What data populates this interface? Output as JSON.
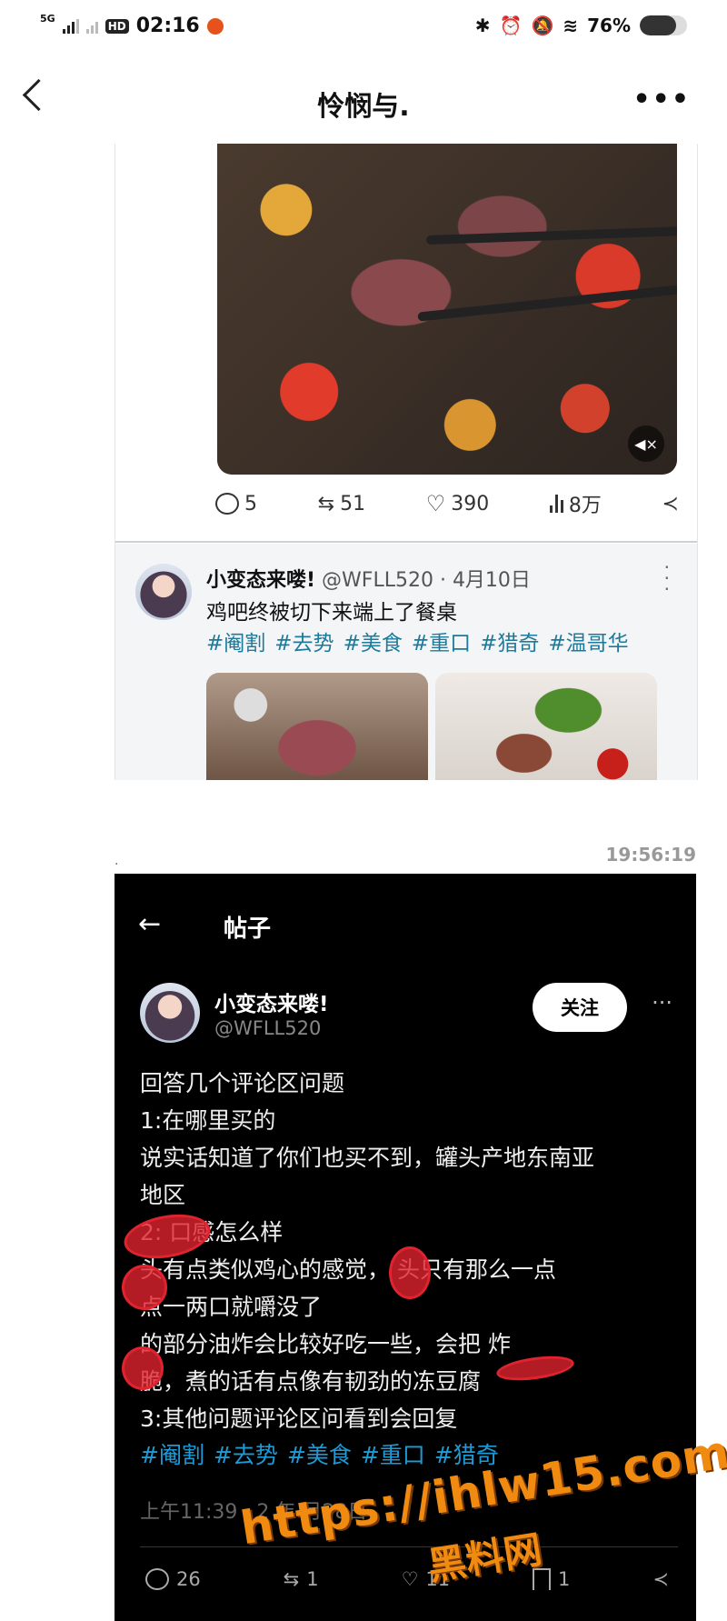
{
  "status_bar": {
    "network": "5G",
    "hd": "HD",
    "time": "02:16",
    "battery": "76%",
    "battery_level": 0.76
  },
  "header": {
    "title": "怜悯与."
  },
  "first_shot": {
    "actions": {
      "replies": "5",
      "reposts": "51",
      "likes": "390",
      "views": "8万"
    },
    "post": {
      "author": "小变态来喽!",
      "handle_date": "@WFLL520 · 4月10日",
      "text": "鸡吧终被切下来端上了餐桌",
      "tags": [
        "#阉割",
        "#去势",
        "#美食",
        "#重口",
        "#猎奇",
        "#温哥华"
      ]
    }
  },
  "message_time": "19:56:19",
  "dot_mark": ".",
  "second_shot": {
    "page_title": "帖子",
    "author": "小变态来喽!",
    "handle": "@WFLL520",
    "follow_label": "关注",
    "body_lines": [
      "回答几个评论区问题",
      "1:在哪里买的",
      "说实话知道了你们也买不到，罐头产地东南亚",
      "地区",
      "2:    口感怎么样",
      "    头有点类似鸡心的感觉，    头只有那么一点",
      "点一两口就嚼没了",
      "    的部分油炸会比较好吃一些，会把          炸",
      "脆，煮的话有点像有韧劲的冻豆腐",
      "3:其他问题评论区问看到会回复"
    ],
    "tags": [
      "#阉割",
      "#去势",
      "#美食",
      "#重口",
      "#猎奇"
    ],
    "time": "上午11:39 · 2    年  月28日",
    "actions": {
      "replies": "26",
      "reposts": "1",
      "likes": "11",
      "bookmarks": "1"
    }
  },
  "watermark": {
    "url": "https://ihlw15.com",
    "name": "黑料网"
  }
}
